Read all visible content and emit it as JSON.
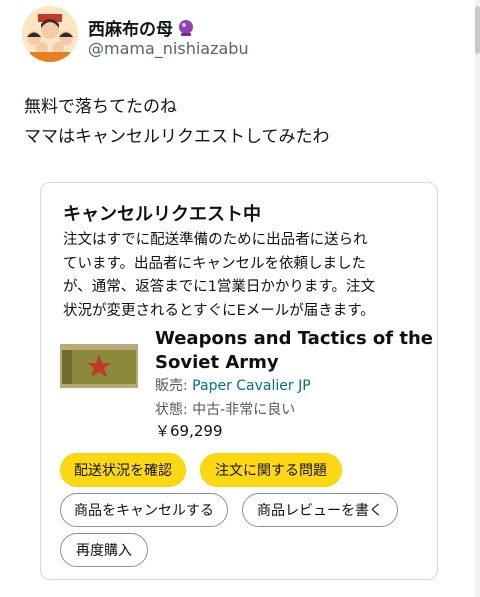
{
  "author": {
    "display_name": "西麻布の母",
    "badge_icon": "crystal-ball-emoji",
    "handle": "@mama_nishiazabu"
  },
  "tweet": {
    "lines": [
      "無料で落ちてたのね",
      "ママはキャンセルリクエストしてみたわ"
    ]
  },
  "card": {
    "title": "キャンセルリクエスト中",
    "description_lines": [
      "注文はすでに配送準備のために出品者に送られ",
      "ています。出品者にキャンセルを依頼しました",
      "が、通常、返答までに1営業日かかります。注文",
      "状況が変更されるとすぐにEメールが届きます。"
    ],
    "product": {
      "title_lines": [
        "Weapons and Tactics of the",
        "Soviet Army"
      ],
      "seller_label": "販売:",
      "seller_name": "Paper Cavalier JP",
      "condition": "状態: 中古-非常に良い",
      "price": "￥69,299"
    },
    "buttons": {
      "track": "配送状況を確認",
      "problem": "注文に関する問題",
      "cancel": "商品をキャンセルする",
      "review": "商品レビューを書く",
      "rebuy": "再度購入"
    }
  },
  "colors": {
    "button_yellow": "#ffd814",
    "link": "#007185",
    "secondary_text": "#565959",
    "handle_text": "#536471"
  }
}
